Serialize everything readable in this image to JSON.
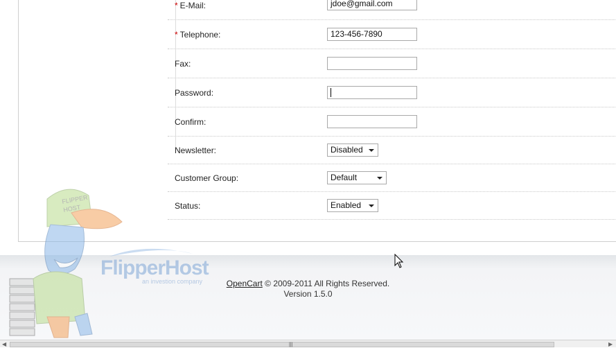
{
  "form": {
    "email": {
      "label": "E-Mail:",
      "required_mark": "*",
      "value": "jdoe@gmail.com"
    },
    "telephone": {
      "label": "Telephone:",
      "required_mark": "*",
      "value": "123-456-7890"
    },
    "fax": {
      "label": "Fax:",
      "value": ""
    },
    "password": {
      "label": "Password:",
      "value": ""
    },
    "confirm": {
      "label": "Confirm:",
      "value": ""
    },
    "newsletter": {
      "label": "Newsletter:",
      "selected": "Disabled"
    },
    "customer_group": {
      "label": "Customer Group:",
      "selected": "Default"
    },
    "status": {
      "label": "Status:",
      "selected": "Enabled"
    }
  },
  "footer": {
    "link": "OpenCart",
    "copyright": "© 2009-2011 All Rights Reserved.",
    "version": "Version 1.5.0"
  },
  "watermark": {
    "brand": "FlipperHost",
    "tagline": "an investion company",
    "cap_text": "FLIPPER HOST"
  },
  "colors": {
    "required": "#cc0000",
    "watermark_blue": "#7fa6d6"
  }
}
